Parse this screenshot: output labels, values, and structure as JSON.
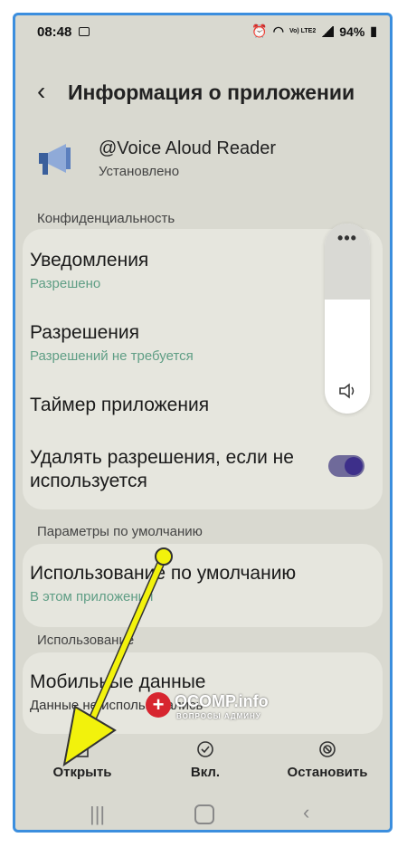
{
  "status_bar": {
    "time": "08:48",
    "lte": "Vo) LTE2",
    "battery": "94%"
  },
  "header": {
    "back_icon": "chevron-left-icon",
    "title": "Информация о приложении"
  },
  "app": {
    "name": "@Voice Aloud Reader",
    "status": "Установлено",
    "icon": "megaphone-icon"
  },
  "sections": {
    "privacy": "Конфиденциальность",
    "defaults": "Параметры по умолчанию",
    "usage": "Использование"
  },
  "privacy_items": {
    "notifications": {
      "title": "Уведомления",
      "subtitle": "Разрешено"
    },
    "permissions": {
      "title": "Разрешения",
      "subtitle": "Разрешений не требуется"
    },
    "timer": {
      "title": "Таймер приложения"
    },
    "remove_permissions": {
      "title_line1": "Удалять разрешения, если не",
      "title_line2": "используется",
      "enabled": true
    }
  },
  "defaults_items": {
    "default_use": {
      "title": "Использование по умолчанию",
      "subtitle": "В этом приложении"
    }
  },
  "usage_items": {
    "mobile_data": {
      "title": "Мобильные данные",
      "subtitle": "Данные не использовались"
    }
  },
  "volume_panel": {
    "dots": "•••",
    "speaker_icon": "speaker-icon"
  },
  "bottom_actions": {
    "open": "Открыть",
    "enable": "Вкл.",
    "stop": "Остановить"
  },
  "watermark": {
    "brand": "OCOMP.info",
    "tagline": "ВОПРОСЫ АДМИНУ",
    "badge": "+"
  },
  "colors": {
    "accent": "#5f9e85",
    "toggle": "#3d2f8a",
    "arrow": "#f2f20c",
    "frame": "#3b8ede"
  }
}
